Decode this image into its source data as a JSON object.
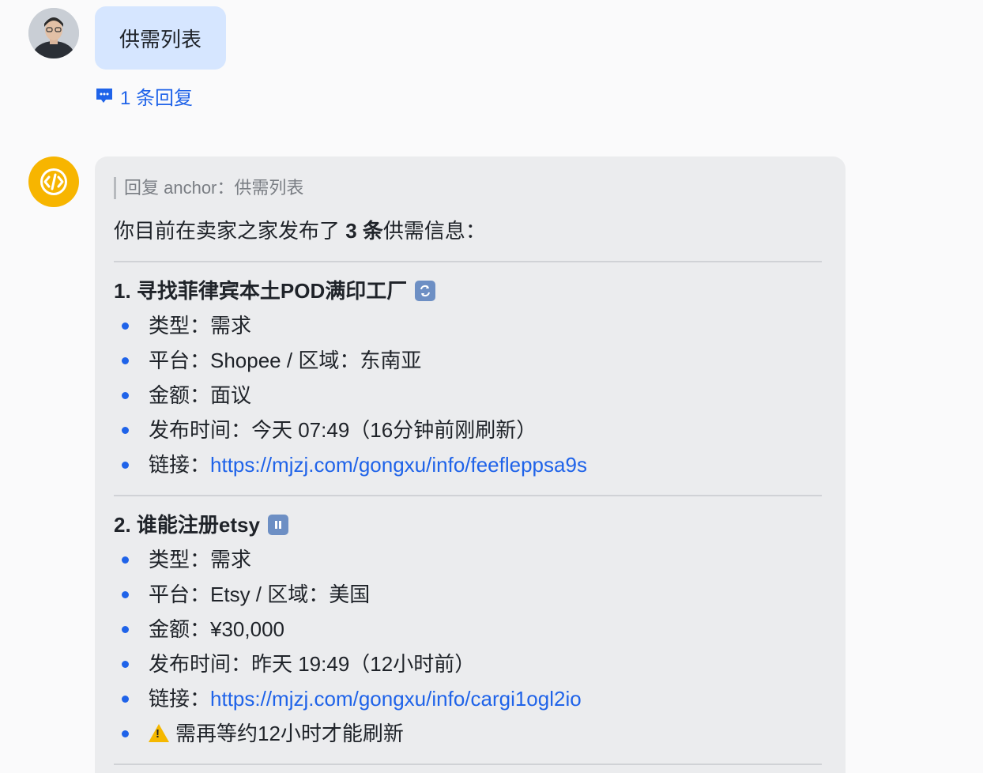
{
  "user_message": {
    "text": "供需列表",
    "reply_count_label": "1 条回复"
  },
  "bot_message": {
    "quote": "回复 anchor：供需列表",
    "intro_prefix": "你目前在卖家之家发布了 ",
    "intro_count": "3 条",
    "intro_suffix": "供需信息：",
    "items": [
      {
        "title": "1. 寻找菲律宾本土POD满印工厂",
        "status_icon": "refresh-emoji-icon",
        "fields": [
          "类型：需求",
          "平台：Shopee / 区域：东南亚",
          "金额：面议",
          "发布时间：今天 07:49（16分钟前刚刷新）"
        ],
        "link_label": "链接：",
        "link_url": "https://mjzj.com/gongxu/info/feefleppsa9s"
      },
      {
        "title": "2. 谁能注册etsy",
        "status_icon": "pause-emoji-icon",
        "fields": [
          "类型：需求",
          "平台：Etsy / 区域：美国",
          "金额：¥30,000",
          "发布时间：昨天 19:49（12小时前）"
        ],
        "link_label": "链接：",
        "link_url": "https://mjzj.com/gongxu/info/cargi1ogl2io",
        "warning": "需再等约12小时才能刷新"
      }
    ]
  },
  "colors": {
    "accent": "#1f63e9",
    "user_bubble": "#d6e6ff",
    "bot_bubble": "#ebecee",
    "bot_avatar": "#f7b500"
  }
}
